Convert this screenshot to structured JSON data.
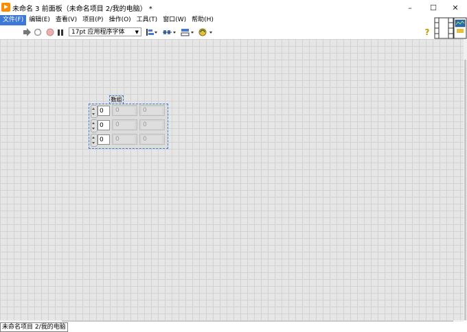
{
  "window": {
    "title": "未命名 3 前面板（未命名项目 2/我的电脑） *",
    "minimize": "–",
    "maximize": "☐",
    "close": "✕"
  },
  "menu": [
    "文件(F)",
    "编辑(E)",
    "查看(V)",
    "项目(P)",
    "操作(O)",
    "工具(T)",
    "窗口(W)",
    "帮助(H)"
  ],
  "toolbar": {
    "font_select": "17pt 应用程序字体",
    "help_glyph": "?"
  },
  "array_control": {
    "label": "数组",
    "index_values": [
      "0",
      "0",
      "0"
    ],
    "cells": [
      [
        "0",
        "0"
      ],
      [
        "0",
        "0"
      ],
      [
        "0",
        "0"
      ]
    ]
  },
  "status": {
    "project": "未命名项目 2/我的电脑"
  },
  "colors": {
    "menu_active": "#3b78d8",
    "canvas": "#e6e6e6",
    "grid": "#d2d2d2",
    "app_icon": "#ff8c00"
  }
}
